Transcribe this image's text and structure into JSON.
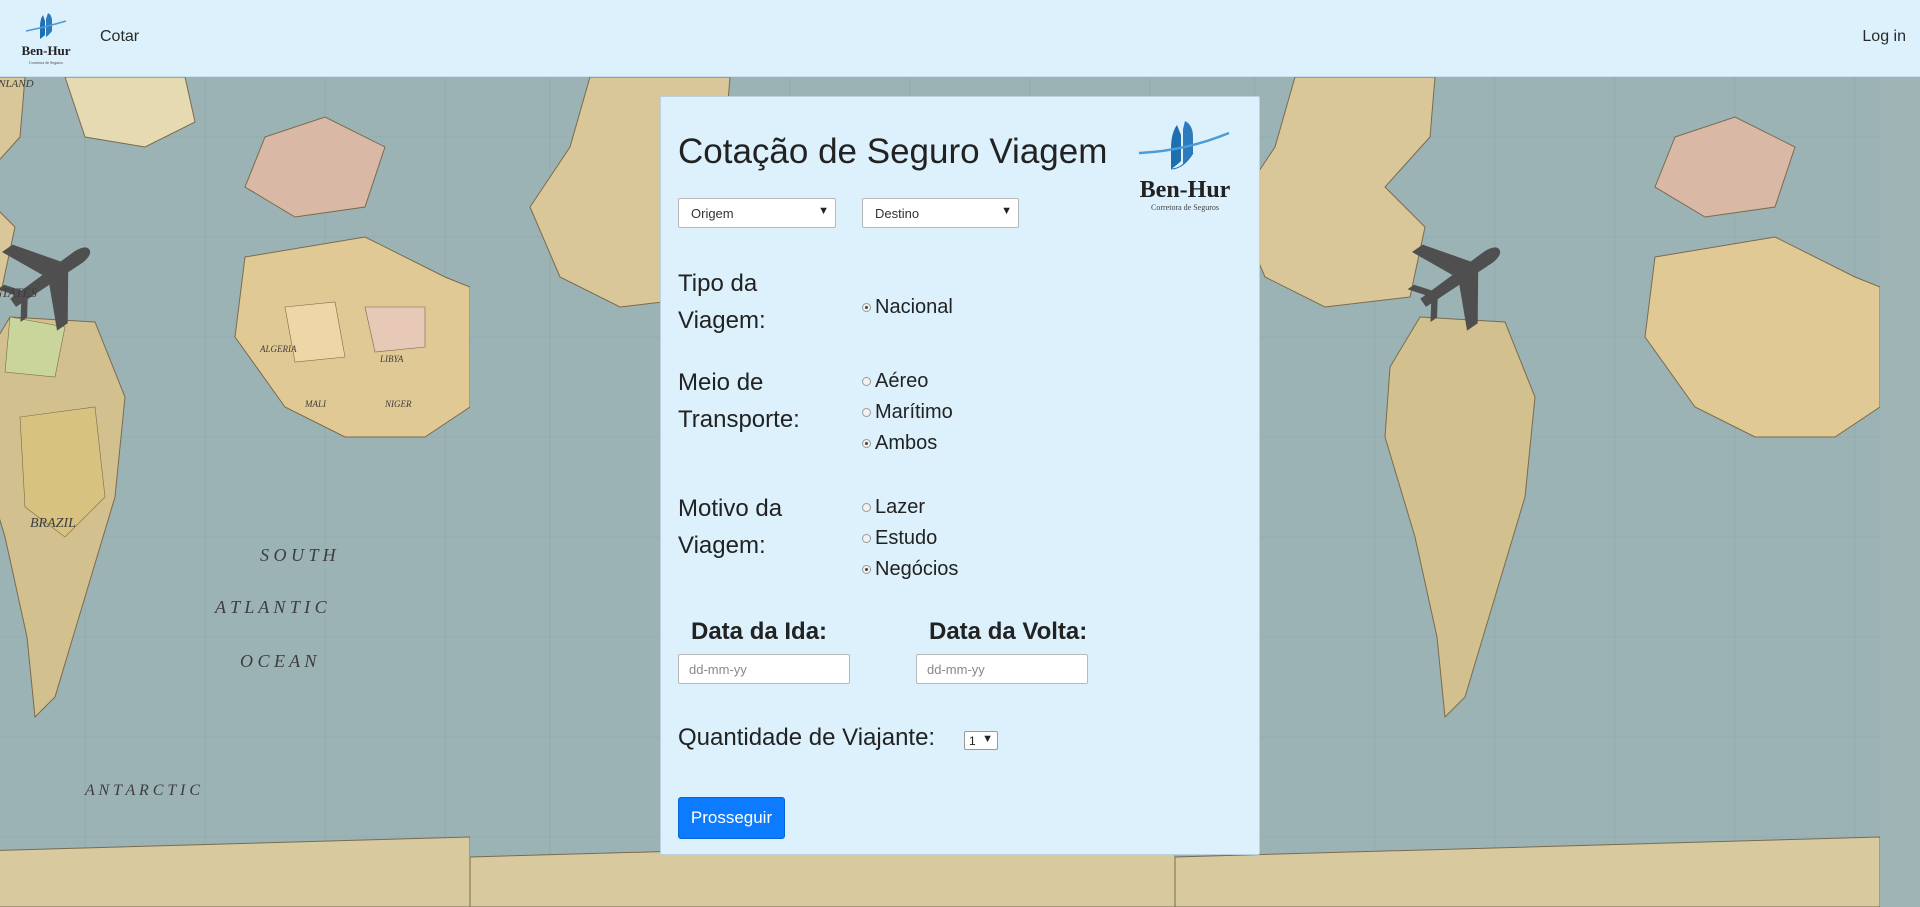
{
  "brand": {
    "name": "Ben-Hur",
    "tagline": "Corretora de Seguros"
  },
  "nav": {
    "cotar": "Cotar",
    "login": "Log in"
  },
  "form": {
    "title": "Cotação de Seguro Viagem",
    "origem": {
      "value": "Origem"
    },
    "destino": {
      "value": "Destino"
    },
    "tipo": {
      "label_line1": "Tipo da",
      "label_line2": "Viagem:",
      "options": [
        {
          "label": "Nacional",
          "checked": true
        }
      ]
    },
    "meio": {
      "label_line1": "Meio de",
      "label_line2": "Transporte:",
      "options": [
        {
          "label": "Aéreo",
          "checked": false
        },
        {
          "label": "Marítimo",
          "checked": false
        },
        {
          "label": "Ambos",
          "checked": true
        }
      ]
    },
    "motivo": {
      "label_line1": "Motivo da",
      "label_line2": "Viagem:",
      "options": [
        {
          "label": "Lazer",
          "checked": false
        },
        {
          "label": "Estudo",
          "checked": false
        },
        {
          "label": "Negócios",
          "checked": true
        }
      ]
    },
    "data_ida": {
      "label": "Data da Ida:",
      "placeholder": "dd-mm-yy"
    },
    "data_volta": {
      "label": "Data da Volta:",
      "placeholder": "dd-mm-yy"
    },
    "quantidade": {
      "label": "Quantidade de Viajante:",
      "value": "1"
    },
    "submit": "Prosseguir"
  },
  "map_text": {
    "greenland": "GREENLAND",
    "states": "STATES",
    "algeria": "ALGERIA",
    "libya": "LIBYA",
    "mali": "MALI",
    "niger": "NIGER",
    "brazil": "BRAZIL",
    "south": "S O U T H",
    "atlantic": "A T L A N T I C",
    "ocean": "O C E A N",
    "antarctic": "A N T A R C T I C"
  },
  "colors": {
    "navbar": "#dcf1fc",
    "card": "#dcf1fc",
    "primary_button": "#0d7bff",
    "logo_blue": "#2d7bbd"
  }
}
